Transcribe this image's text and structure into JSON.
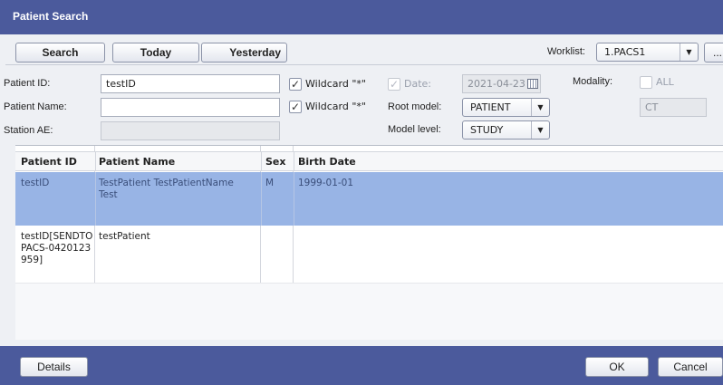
{
  "window": {
    "title": "Patient Search"
  },
  "toolbar": {
    "search_label": "Search",
    "today_label": "Today",
    "yesterday_label": "Yesterday",
    "worklist_label": "Worklist:",
    "worklist_value": "1.PACS1",
    "more_label": "..."
  },
  "form": {
    "patient_id_label": "Patient ID:",
    "patient_id_value": "testID",
    "patient_name_label": "Patient Name:",
    "patient_name_value": "",
    "station_ae_label": "Station AE:",
    "station_ae_value": "",
    "wildcard_label_1": "Wildcard \"*\"",
    "wildcard_label_2": "Wildcard \"*\"",
    "date_label": "Date:",
    "date_value": "2021-04-23",
    "root_model_label": "Root model:",
    "root_model_value": "PATIENT",
    "model_level_label": "Model level:",
    "model_level_value": "STUDY",
    "modality_label": "Modality:",
    "modality_all_label": "ALL",
    "modality_value": "CT"
  },
  "table": {
    "headers": [
      "Patient ID",
      "Patient Name",
      "Sex",
      "Birth Date"
    ],
    "rows": [
      {
        "patient_id": "testID",
        "patient_name": "TestPatient TestPatientName Test",
        "sex": "M",
        "birth_date": "1999-01-01"
      },
      {
        "patient_id": "testID[SENDTOPACS-0420123959]",
        "patient_name": "testPatient",
        "sex": "",
        "birth_date": ""
      }
    ]
  },
  "footer": {
    "details_label": "Details",
    "ok_label": "OK",
    "cancel_label": "Cancel"
  }
}
